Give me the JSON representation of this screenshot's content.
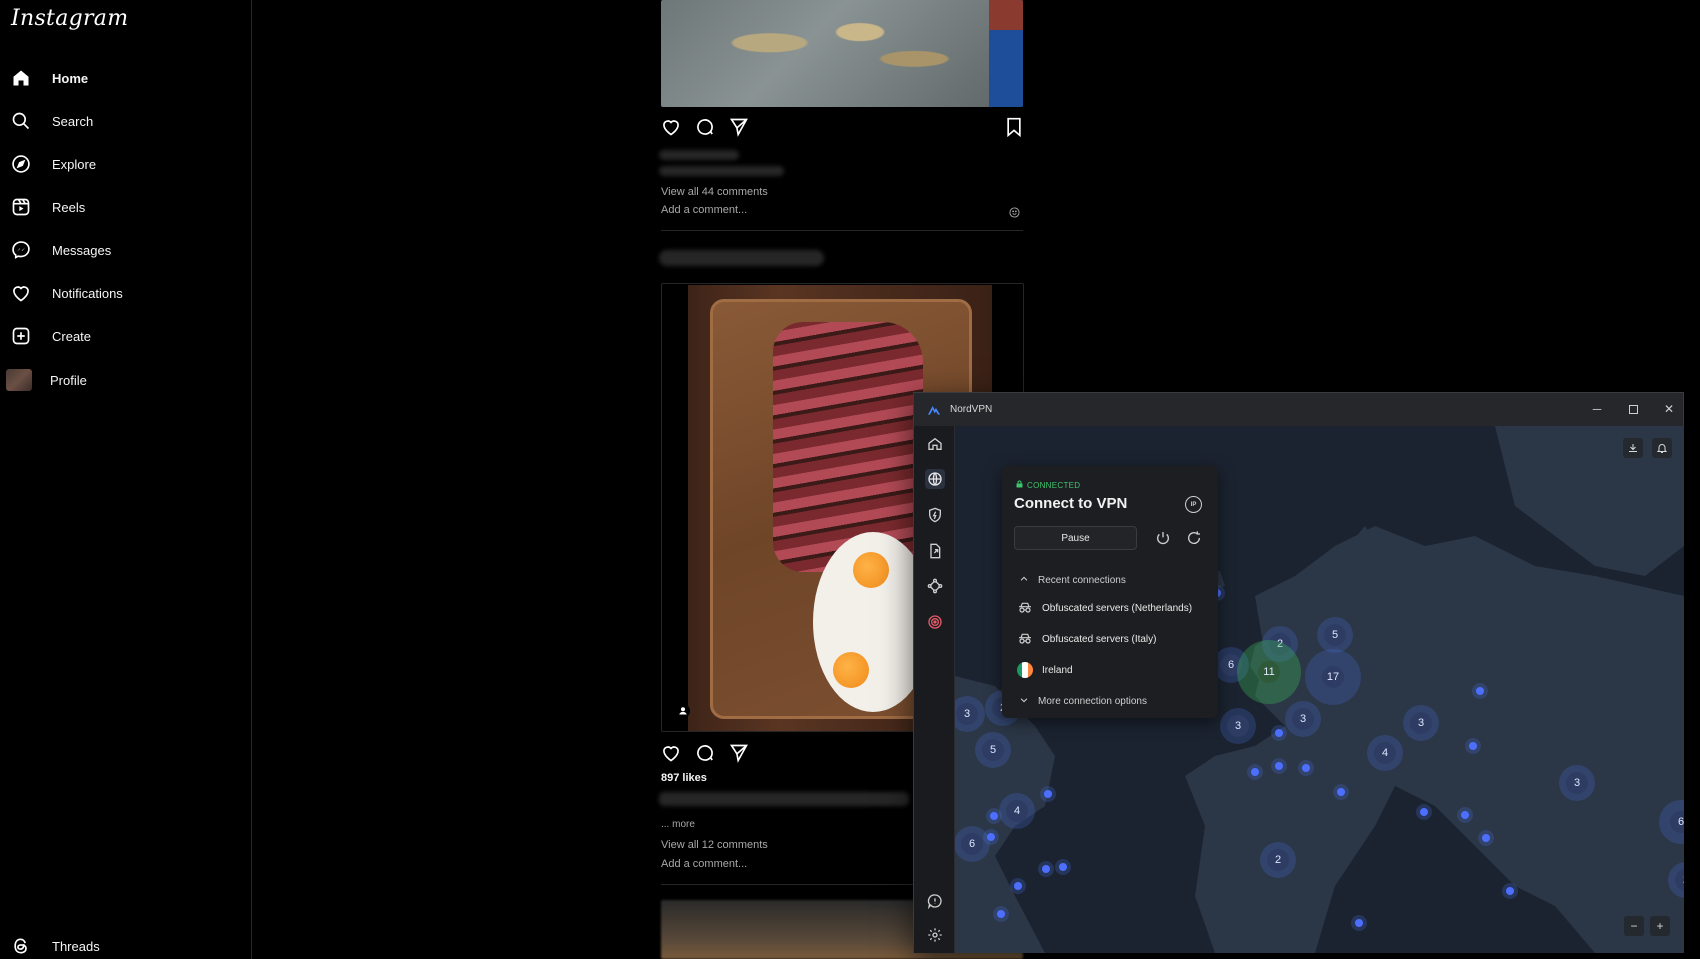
{
  "instagram": {
    "logo": "Instagram",
    "nav": [
      {
        "label": "Home",
        "icon": "home-icon"
      },
      {
        "label": "Search",
        "icon": "search-icon"
      },
      {
        "label": "Explore",
        "icon": "compass-icon"
      },
      {
        "label": "Reels",
        "icon": "reels-icon"
      },
      {
        "label": "Messages",
        "icon": "messenger-icon"
      },
      {
        "label": "Notifications",
        "icon": "heart-icon"
      },
      {
        "label": "Create",
        "icon": "plus-square-icon"
      },
      {
        "label": "Profile",
        "icon": "avatar"
      }
    ],
    "threads": "Threads",
    "post1": {
      "view_comments": "View all 44 comments",
      "add_comment": "Add a comment..."
    },
    "post2": {
      "likes": "897 likes",
      "more": "... more",
      "view_comments": "View all 12 comments",
      "add_comment": "Add a comment..."
    }
  },
  "nordvpn": {
    "window_title": "NordVPN",
    "status": "CONNECTED",
    "panel_title": "Connect to VPN",
    "ip_label": "IP",
    "pause_label": "Pause",
    "recent_header": "Recent connections",
    "recent": [
      {
        "label": "Obfuscated servers (Netherlands)",
        "icon": "obfuscated-icon"
      },
      {
        "label": "Obfuscated servers (Italy)",
        "icon": "obfuscated-icon"
      },
      {
        "label": "Ireland",
        "icon": "ireland-flag"
      }
    ],
    "more_options": "More connection options",
    "clusters": [
      "2",
      "5",
      "6",
      "11",
      "17",
      "3",
      "2",
      "3",
      "3",
      "3",
      "4",
      "5",
      "4",
      "6",
      "2",
      "3",
      "6",
      "2"
    ],
    "zoom_out": "−",
    "zoom_in": "+",
    "colors": {
      "connected": "#3ec46d",
      "accent": "#4687ff",
      "map": "#1b2330"
    }
  }
}
